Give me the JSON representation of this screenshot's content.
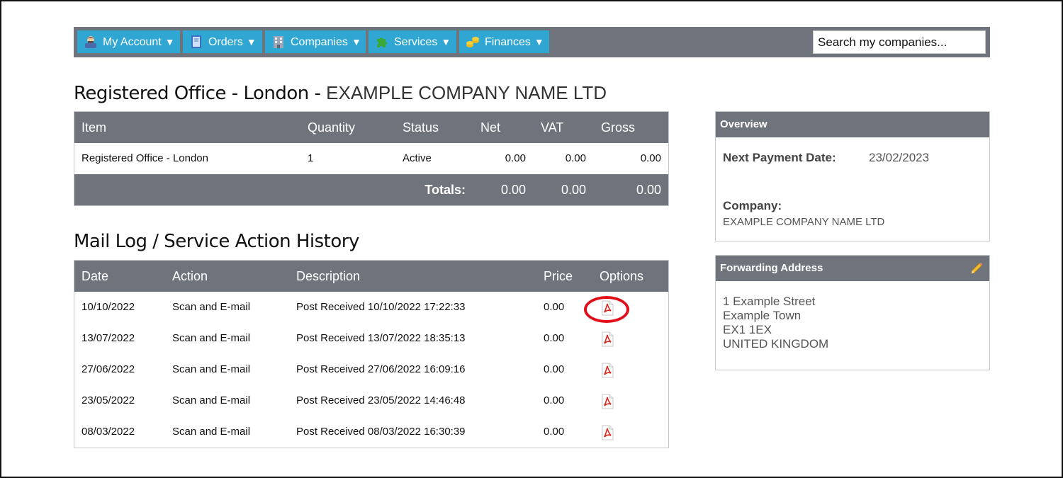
{
  "nav": {
    "items": [
      {
        "label": "My Account",
        "caret": "▼",
        "icon": "user-icon"
      },
      {
        "label": "Orders",
        "caret": "▼",
        "icon": "book-icon"
      },
      {
        "label": "Companies",
        "caret": "▼",
        "icon": "building-icon"
      },
      {
        "label": "Services",
        "caret": "▼",
        "icon": "puzzle-icon"
      },
      {
        "label": "Finances",
        "caret": "▼",
        "icon": "coins-icon"
      }
    ],
    "search_placeholder": "Search my companies..."
  },
  "service": {
    "title_prefix": "Registered Office - London - ",
    "company_name": "EXAMPLE COMPANY NAME LTD",
    "columns": [
      "Item",
      "Quantity",
      "Status",
      "Net",
      "VAT",
      "Gross"
    ],
    "rows": [
      [
        "Registered Office - London",
        "1",
        "Active",
        "0.00",
        "0.00",
        "0.00"
      ]
    ],
    "totals_label": "Totals:",
    "totals": [
      "0.00",
      "0.00",
      "0.00"
    ]
  },
  "mail_log": {
    "title": "Mail Log / Service Action History",
    "columns": [
      "Date",
      "Action",
      "Description",
      "Price",
      "Options"
    ],
    "rows": [
      [
        "10/10/2022",
        "Scan and E-mail",
        "Post Received 10/10/2022 17:22:33",
        "0.00"
      ],
      [
        "13/07/2022",
        "Scan and E-mail",
        "Post Received 13/07/2022 18:35:13",
        "0.00"
      ],
      [
        "27/06/2022",
        "Scan and E-mail",
        "Post Received 27/06/2022 16:09:16",
        "0.00"
      ],
      [
        "23/05/2022",
        "Scan and E-mail",
        "Post Received 23/05/2022 14:46:48",
        "0.00"
      ],
      [
        "08/03/2022",
        "Scan and E-mail",
        "Post Received 08/03/2022 16:30:39",
        "0.00"
      ]
    ],
    "option_icon": "pdf-icon"
  },
  "overview": {
    "title": "Overview",
    "next_payment_label": "Next Payment Date:",
    "next_payment_value": "23/02/2023",
    "company_label": "Company:",
    "company_value": "EXAMPLE COMPANY NAME LTD"
  },
  "forwarding": {
    "title": "Forwarding Address",
    "edit_icon": "pencil-icon",
    "lines": [
      "1 Example Street",
      "Example Town",
      "EX1 1EX",
      "UNITED KINGDOM"
    ]
  },
  "colors": {
    "header_gray": "#6f737c",
    "nav_blue": "#2fa7d2",
    "highlight_red": "#e0101a",
    "pdf_red": "#d7261c"
  }
}
